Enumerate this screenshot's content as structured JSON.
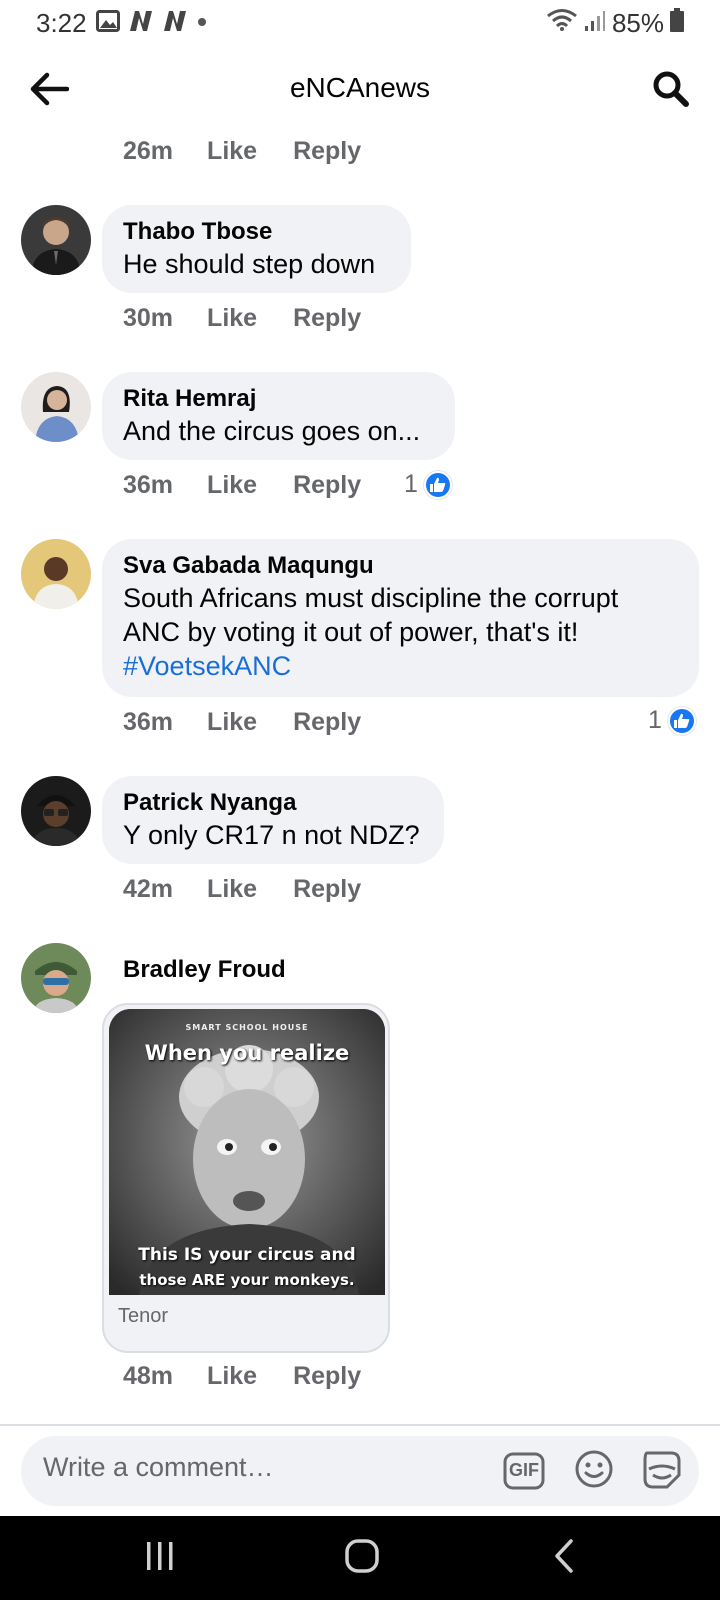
{
  "status_bar": {
    "time": "3:22",
    "battery": "85%",
    "icons": [
      "gallery-icon",
      "n-app-icon",
      "n-app-icon",
      "dot-icon",
      "wifi-icon",
      "signal-icon",
      "battery-icon"
    ]
  },
  "header": {
    "title": "eNCAnews",
    "icons": [
      "back-arrow-icon",
      "search-icon"
    ]
  },
  "top_partial": {
    "time": "26m",
    "like": "Like",
    "reply": "Reply"
  },
  "comments": [
    {
      "author": "Thabo Tbose",
      "text": "He should step down",
      "time": "30m",
      "like": "Like",
      "reply": "Reply"
    },
    {
      "author": "Rita Hemraj",
      "text": "And the circus goes on...",
      "time": "36m",
      "like": "Like",
      "reply": "Reply",
      "reactions": "1"
    },
    {
      "author": "Sva Gabada Maqungu",
      "text_line1": "South Africans must discipline the corrupt",
      "text_line2": "ANC by voting it out of power, that's it!",
      "hashtag": "#VoetsekANC",
      "time": "36m",
      "like": "Like",
      "reply": "Reply",
      "reactions": "1"
    },
    {
      "author": "Patrick Nyanga",
      "text": "Y only CR17 n not NDZ?",
      "time": "42m",
      "like": "Like",
      "reply": "Reply"
    },
    {
      "author": "Bradley Froud",
      "gif_top_text": "When you realize",
      "gif_small_text": "SMART SCHOOL HOUSE",
      "gif_bottom_line1": "This IS your circus and",
      "gif_bottom_line2": "those ARE your monkeys.",
      "gif_source": "Tenor",
      "time": "48m",
      "like": "Like",
      "reply": "Reply"
    }
  ],
  "composer": {
    "placeholder": "Write a comment…",
    "gif_label": "GIF",
    "icons": [
      "gif-icon",
      "emoji-icon",
      "sticker-icon"
    ]
  },
  "nav_bar": {
    "icons": [
      "recent-apps-icon",
      "home-icon",
      "back-icon"
    ]
  },
  "colors": {
    "bubble": "#f0f2f5",
    "meta": "#65676b",
    "hashtag": "#1b6ed6",
    "like_blue": "#1877f2"
  }
}
